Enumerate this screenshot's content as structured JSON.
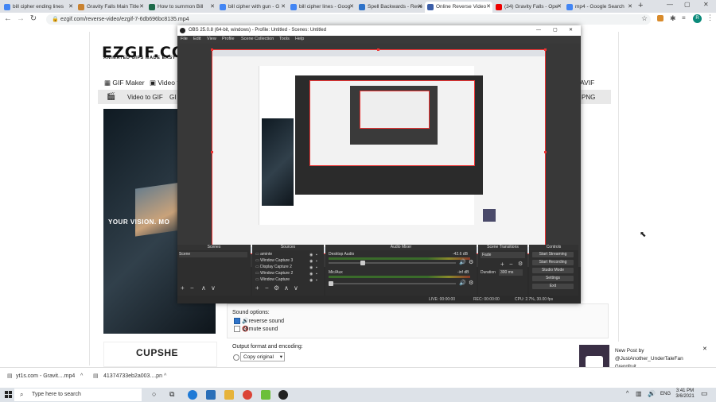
{
  "browser": {
    "tabs": [
      {
        "label": "bill cipher ending lines",
        "color": "#4285f4"
      },
      {
        "label": "Gravity Falls Main Title",
        "color": "#c9822f"
      },
      {
        "label": "How to summon Bill",
        "color": "#1e6a4a"
      },
      {
        "label": "bill cipher with gun - G",
        "color": "#4285f4"
      },
      {
        "label": "bill cipher lines - Goog",
        "color": "#4285f4"
      },
      {
        "label": "Spell Backwards - Reve",
        "color": "#2f73c9"
      },
      {
        "label": "Online Reverse Video",
        "color": "#3b5ea8"
      },
      {
        "label": "(34) Gravity Falls - Ope",
        "color": "#e00"
      },
      {
        "label": "mp4 - Google Search",
        "color": "#4285f4"
      }
    ],
    "url": "ezgif.com/reverse-video/ezgif-7-6db696bc8135.mp4"
  },
  "site": {
    "logo": "EZGIF.COM",
    "tagline": "ANIMATED GIFS MADE EASY",
    "nav_main": [
      "GIF Maker",
      "Video to"
    ],
    "nav_main_right": "AVIF",
    "nav_sub": [
      "Video to GIF",
      "GI"
    ],
    "nav_sub_right": "PNG",
    "ad_text": "YOUR VISION. MO",
    "ad2_brand": "CUPSHE",
    "sound_options_label": "Sound options:",
    "reverse_sound": "reverse sound",
    "mute_sound": "mute sound",
    "output_label": "Output format and encoding:",
    "output_select": "Copy original"
  },
  "obs": {
    "title": "OBS 25.0.8 (64-bit, windows) - Profile: Untitled - Scenes: Untitled",
    "menu": [
      "File",
      "Edit",
      "View",
      "Profile",
      "Scene Collection",
      "Tools",
      "Help"
    ],
    "docks": {
      "scenes": "Scenes",
      "sources": "Sources",
      "mixer": "Audio Mixer",
      "transitions": "Scene Transitions",
      "controls": "Controls"
    },
    "scene_item": "Scene",
    "sources": [
      "aminte",
      "Window Capture 3",
      "Display Capture 2",
      "Window Capture 2",
      "Window Capture"
    ],
    "mixer": [
      {
        "name": "Desktop Audio",
        "db": "-42.6 dB"
      },
      {
        "name": "Mic/Aux",
        "db": "-inf dB"
      }
    ],
    "transition": "Fade",
    "duration_label": "Duration",
    "duration_value": "300 ms",
    "controls": [
      "Start Streaming",
      "Start Recording",
      "Studio Mode",
      "Settings",
      "Exit"
    ],
    "status": {
      "live": "LIVE: 00:00:00",
      "rec": "REC: 00:00:00",
      "cpu": "CPU: 2.7%, 30.00 fps"
    }
  },
  "notification": {
    "title": "New Post by",
    "user": "@JustAnother_UnderTaleFan",
    "text": "Greppfruit",
    "source": "game-jolt-client"
  },
  "downloads": [
    {
      "name": "yt1s.com - Gravit....mp4"
    },
    {
      "name": "41374733eb2a003....pn"
    }
  ],
  "taskbar": {
    "search_placeholder": "Type here to search",
    "lang": "ENG",
    "time": "3:41 PM",
    "date": "3/6/2021"
  }
}
